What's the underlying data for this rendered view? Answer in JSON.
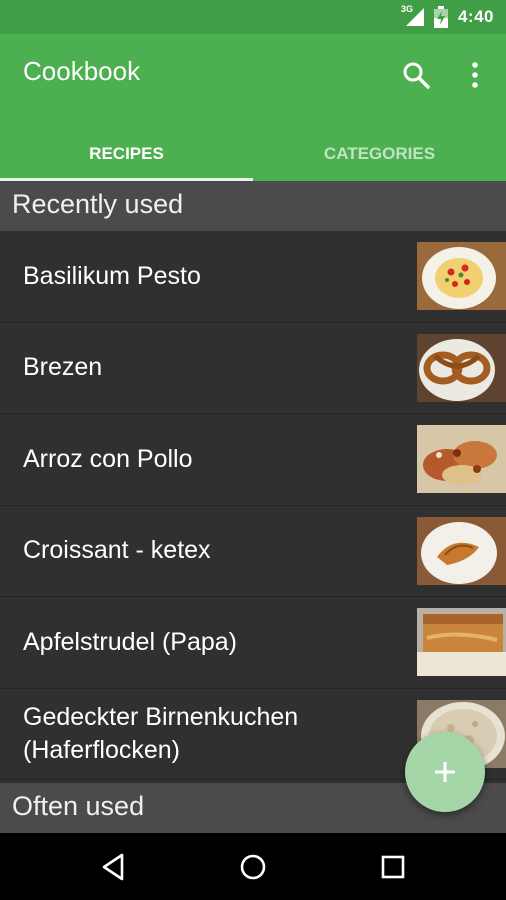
{
  "status_bar": {
    "network": "3G",
    "time": "4:40"
  },
  "app_bar": {
    "title": "Cookbook",
    "icons": [
      "search-icon",
      "more-vert-icon"
    ],
    "tabs": [
      {
        "label": "RECIPES",
        "active": true
      },
      {
        "label": "CATEGORIES",
        "active": false
      }
    ]
  },
  "sections": {
    "recently_used": "Recently used",
    "often_used": "Often used"
  },
  "recipes": [
    {
      "name": "Basilikum Pesto",
      "thumbnail": "pasta-pesto-photo"
    },
    {
      "name": "Brezen",
      "thumbnail": "pretzel-photo"
    },
    {
      "name": "Arroz con Pollo",
      "thumbnail": "rice-chicken-photo"
    },
    {
      "name": "Croissant - ketex",
      "thumbnail": "croissant-photo"
    },
    {
      "name": "Apfelstrudel (Papa)",
      "thumbnail": "strudel-photo"
    },
    {
      "name": "Gedeckter Birnenkuchen (Haferflocken)",
      "thumbnail": "pear-cake-photo"
    }
  ],
  "fab": {
    "icon": "add-icon"
  },
  "colors": {
    "primary": "#4caf50",
    "primary_dark": "#3f9e46",
    "fab": "#a5d6a7",
    "background": "#303030",
    "section_header": "#4b4b4b"
  },
  "nav_bar": {
    "icons": [
      "back-icon",
      "home-icon",
      "recents-icon"
    ]
  }
}
